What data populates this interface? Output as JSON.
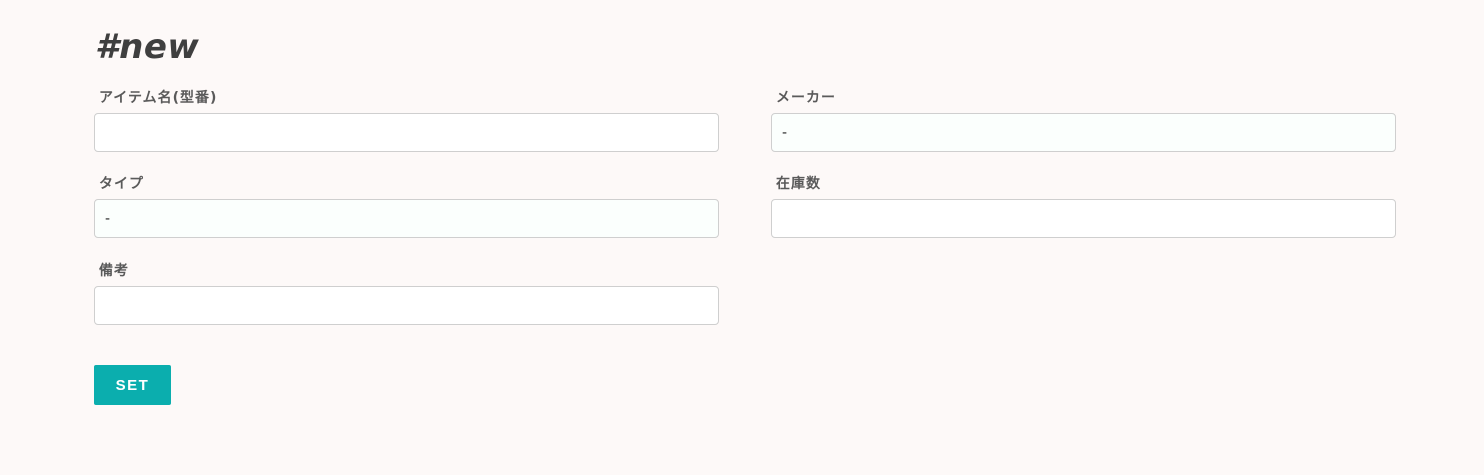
{
  "header": {
    "title": "#new"
  },
  "form": {
    "fields": {
      "item_name": {
        "label": "アイテム名(型番)",
        "value": ""
      },
      "maker": {
        "label": "メーカー",
        "value": "-"
      },
      "type": {
        "label": "タイプ",
        "value": "-"
      },
      "stock": {
        "label": "在庫数",
        "value": ""
      },
      "note": {
        "label": "備考",
        "value": ""
      }
    },
    "submit_label": "SET"
  },
  "colors": {
    "background": "#fdf9f8",
    "accent": "#0baeae",
    "title": "#3f3f3f",
    "label": "#5a5a5a"
  }
}
